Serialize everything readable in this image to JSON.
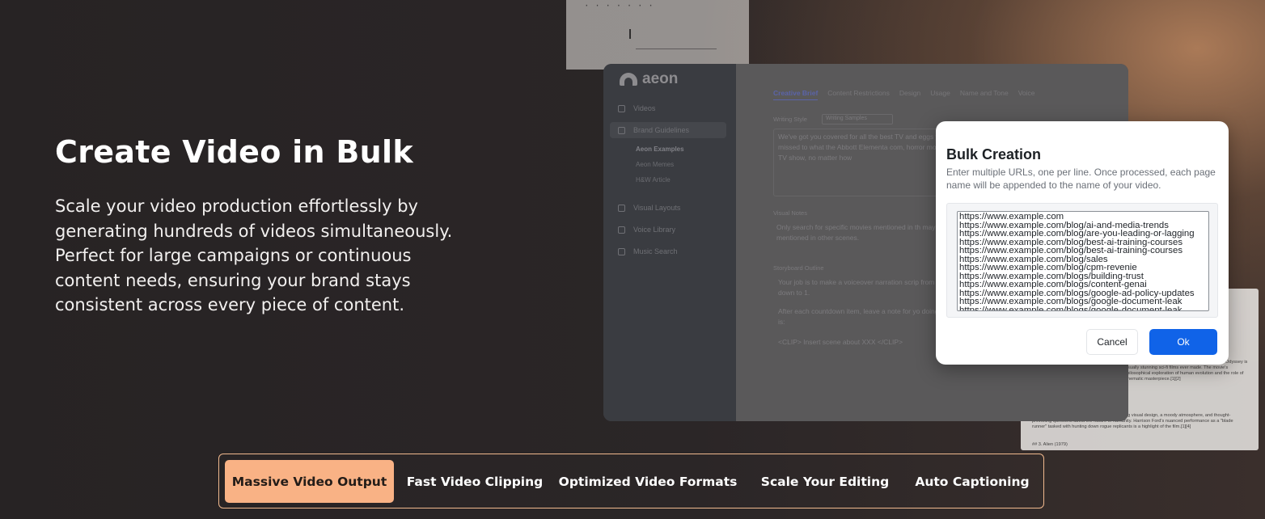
{
  "hero": {
    "title": "Create Video in Bulk",
    "description": "Scale your video production effortlessly by generating hundreds of videos simultaneously. Perfect for large campaigns or continuous content needs, ensuring your brand stays consistent across every piece of content."
  },
  "background_paper": {
    "top_scribble": "·  ·  ·     ·   ·  ·  ·",
    "bottom_text_1": "ed on the work of Arthur C. Clarke, 2001: A Space Odyssey is visually stunning sci-fi films ever made. The movie's philosophical exploration of human evolution and the role of cinematic masterpiece.[1][2]",
    "bottom_text_2": "...ential work of science fiction, blending stunning visual design, a moody atmosphere, and thought-provoking questions about the nature of humanity. Harrison Ford's nuanced performance as a \"blade runner\" tasked with hunting down rogue replicants is a highlight of the film.[1][4]",
    "bottom_heading": "## 3. Alien (1979)"
  },
  "app": {
    "logo_text": "aeon",
    "nav": [
      {
        "label": "Videos",
        "icon": "video-icon"
      },
      {
        "label": "Brand Guidelines",
        "icon": "document-icon"
      },
      {
        "label": "Visual Layouts",
        "icon": "layout-icon"
      },
      {
        "label": "Voice Library",
        "icon": "voice-icon"
      },
      {
        "label": "Music Search",
        "icon": "music-icon"
      }
    ],
    "sub_nav": [
      "Aeon Examples",
      "Aeon Memes",
      "H&W Article"
    ],
    "tabs": [
      "Creative Brief",
      "Content Restrictions",
      "Design",
      "Usage",
      "Name and Tone",
      "Voice"
    ],
    "writing_style_label": "Writing Style",
    "writing_style_value": "Writing Samples",
    "brief_text": "We've got you covered for all the best TV and eggs you missed to what the Abbott Elementa com, horror movie, or TV show, no matter how",
    "visual_notes_label": "Visual Notes",
    "visual_notes_text": "Only search for specific movies mentioned in th may be mentioned in other scenes.",
    "storyboard_label": "Storyboard Outline",
    "storyboard_text_1": "Your job is to make a voiceover narration scrip from 5 down to 1.",
    "storyboard_text_2": "After each countdown item, leave a note for yo doing so is:",
    "storyboard_text_3": "<CLIP> Insert scene about XXX </CLIP>"
  },
  "modal": {
    "title": "Bulk Creation",
    "description": "Enter multiple URLs, one per line. Once processed, each page name will be appended to the name of your video.",
    "urls": [
      "https://www.example.com",
      "https://www.example.com/blog/ai-and-media-trends",
      "https://www.example.com/blog/are-you-leading-or-lagging",
      "https://www.example.com/blog/best-ai-training-courses",
      "https://www.example.com/blog/best-ai-training-courses",
      "https://www.example.com/blog/sales",
      "https://www.example.com/blog/cpm-revenie",
      "https://www.example.com/blogs/building-trust",
      "https://www.example.com/blogs/content-genai",
      "https://www.example.com/blogs/google-ad-policy-updates",
      "https://www.example.com/blogs/google-document-leak",
      "https://www.example.com/blogs/google-document-leak"
    ],
    "cancel_label": "Cancel",
    "ok_label": "Ok",
    "ok_color": "#1063e8"
  },
  "features": {
    "tabs": [
      "Massive Video Output",
      "Fast Video Clipping",
      "Optimized Video Formats",
      "Scale Your Editing",
      "Auto Captioning"
    ],
    "active_index": 0,
    "accent": "#f9b285"
  }
}
